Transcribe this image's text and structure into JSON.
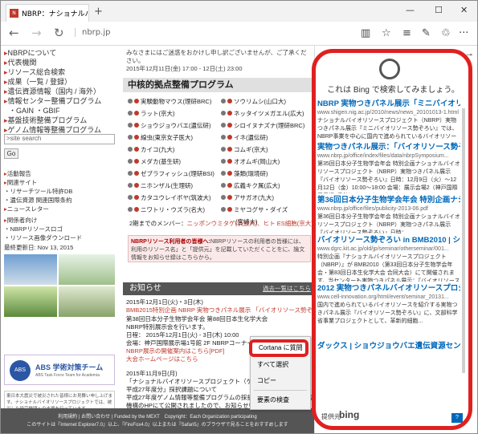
{
  "tab": {
    "title": "NBRP：ナショナルバイオリ",
    "favicon": "N",
    "close": "✕",
    "new": "+"
  },
  "window": {
    "min": "—",
    "max": "☐",
    "close": "✕"
  },
  "nav": {
    "back": "←",
    "forward": "→",
    "refresh": "↻",
    "url": "nbrp.jp",
    "icons": {
      "reading": "▥",
      "fav": "☆",
      "hub": "≡",
      "note": "✎",
      "share": "♲",
      "more": "···"
    }
  },
  "left": {
    "items": [
      "NBRPについて",
      "代表機関",
      "リソース総合検索",
      "成果（一覧 / 登録）",
      "遺伝資源情報（国内 / 海外）",
      "情報センター整備プログラム",
      "・GAIN ・GBIF",
      "基盤技術整備プログラム",
      "ゲノム情報等整備プログラム"
    ],
    "search_placeholder": ">site search",
    "go": "Go",
    "links": [
      "活動報告",
      "関連サイト",
      "・リサーチツール特許DB",
      "・遺伝資源 関連国際条約",
      "ニュースレター",
      "関係者向け",
      "・NBRPリソースロゴ",
      "・リソース画像ダウンロード"
    ],
    "updated": "最終更新日: Nov 13, 2015",
    "abs": {
      "title": "ABS 学術対策チーム",
      "sub": "ABS Task Force Team for Academia"
    },
    "notice": "東日本大震災で被災された皆様にお見舞い申し上げます。ナショナルバイオリソースプロジェクトでは、被災した研究機関への支援を行っています。"
  },
  "main": {
    "intro": "みなさまにはご迷惑をおかけし申し訳ございませんが、ご了承ください。\n2015年12月11日(金) 17:00 - 12日(土) 23:00",
    "core_title": "中核的拠点整備プログラム",
    "programs_left": [
      "実験動物マウス(理研BRC)",
      "ラット(京大)",
      "ショウジョウバエ(遺伝研)",
      "線虫(東京女子医大)",
      "カイコ(九大)",
      "メダカ(基生研)",
      "ゼブラフィッシュ(理研BSI)",
      "ニホンザル(生理研)",
      "カタユウレイボヤ(筑波大)",
      "ニワトリ・ウズラ(名大)"
    ],
    "programs_right": [
      "ソウリムシ(山口大)",
      "ネッタイツメガエル(広大)",
      "シロイヌナズナ(理研BRC)",
      "イネ(遺伝研)",
      "コムギ(京大)",
      "オオムギ(岡山大)",
      "藻類(環境研)",
      "広義キク属(広大)",
      "アサガオ(九大)",
      "ミヤコグサ・ダイズ",
      "(宮崎大)"
    ],
    "members_label": "2期までのメンバー：",
    "members": "ニッポンウミタゲ(筑波大)、ヒト ES細胞(京大)",
    "nbrp_head": "NBRPリソース利用者の皆様へ:",
    "nbrp_text": "NBRPリソースの利用者の皆様には、利用のリソース名」と「提供元」を記載していただくことをに、論文情報をお知らせ録はこちらから。",
    "news_title": "お知らせ",
    "news_more": "過去一覧はこちら",
    "news": [
      "2015年12月1日(火)・3日(木)",
      "BMB2015特別企画 NBRP 実物つきパネル展示 「バイオリソース勢ぞろい」",
      "第38回日本分子生物学会年会 第88回日本生化学大会",
      "NBRP特別展示会を行います。",
      "日程： 2015年12月1日(火) - 3日(木) 10:00",
      "会場：神戸国際展示場1号館 2F NBRPコーナー",
      "NBRP展示の開催案内はこちら[PDF]",
      "大会ホームページはこちら",
      "2015年11月9日(月)",
      "「ナショナルバイオリソースプロジェクト（ゲノ",
      "平成27年度分」採択課題について",
      "平成27年度ゲノム情報等整備プログラムの採択機関が、日本医療研究開発",
      "機構のHPにて公開されましたので、お知らせいたします。",
      "詳しくはこちら"
    ],
    "footer1": "利用規約 | お問い合わせ | Funded by the MEXT　Copyright：Each Organization participating",
    "footer2": "このサイトは『Internet Explorer7.0』以上、『FireFox4.0』以上または『Safari5』のブラウザで見ることをおすすめします"
  },
  "context_menu": [
    "Cortana に質問",
    "すべて選択",
    "コピー",
    "要素の検査"
  ],
  "cortana": {
    "title": "これは Bing で検索してみましょう。",
    "results": [
      {
        "title": "NBRP 実物つきパネル展示「ミニバイオリソー...",
        "url": "www.shigen.nig.ac.jp/2010/news/news_20101013-1.html",
        "snippet": "ナショナルバイオリソースプロジェクト（NBRP）実物つきパネル展示『ミニバイオリソース勢ぞろい』では、NBRP事業を中心に国内で進められているバイオリソース..."
      },
      {
        "title": "実物つきパネル展示：「バイオリソース勢ぞろ...",
        "url": "www.nbrp.jp/office/index/files/data/nbrpSymposium...",
        "snippet": "第35回日本分子生物学会年会 特別企画ナショナルバイオリソースプロジェクト（NBRP）実物つきパネル展示『バイオリソース勢ぞろい』日時：12月9日（火）～12月12日（金）10:00～18:00 会場：展示会場2（神戸国際展示場3号館）ナショナルバイオ..."
      },
      {
        "title": "第36回日本分子生物学会年会 特別企画ナショナル...",
        "url": "www.nbrp.jp/office/files/publicity-2013-06.pdf",
        "snippet": "第36回日本分子生物学会年会 特別企画ナショナルバイオリソースプロジェクト（NBRP）実物つきパネル展示『バイオリソース勢ぞろい』日時：..."
      },
      {
        "title": "バイオリソース勢ぞろい in BMB2010 | ショウジ...",
        "url": "www.dgrc.kit.ac.jp/old/jp/seminar/otherseminar/001...",
        "snippet": "特別企画『ナショナルバイオリソースプロジェクト（NBRP）』が BMB2010（第33回日本分子生物学会年会・第83回日本生化学大会 合同大会）にて開催されます。当センターも実物つきパネル展示：『バイオリソース勢ぞろい..."
      },
      {
        "title": "2012 実物つきパネルバイオリソースプロジェクト | ...",
        "url": "www.cell-innovation.org/html/event/seminar_20131...",
        "snippet": "国内で進められているバイオリソースを紹介する実物つきパネル展示『バイオリソース勢ぞろい』に、文部科学省事業プロジェクトとして、革新的細胞..."
      },
      {
        "title": "ダックス | ショウジョウバエ遺伝資源センター...",
        "url": "",
        "snippet": ""
      }
    ],
    "provider": "提供元",
    "bing": "bing",
    "ask": "?"
  }
}
